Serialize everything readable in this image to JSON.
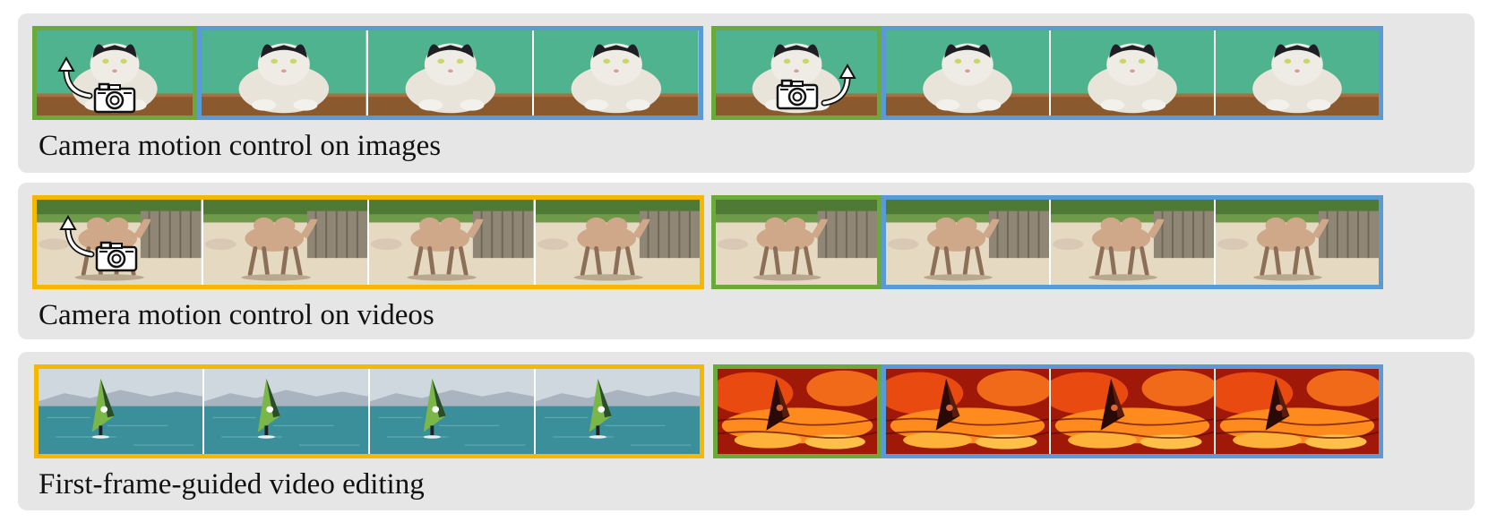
{
  "rows": [
    {
      "caption": "Camera motion control on images"
    },
    {
      "caption": "Camera motion control on videos"
    },
    {
      "caption": "First-frame-guided video editing"
    }
  ],
  "colors": {
    "panel_background": "#e6e6e6",
    "conditioning_frame_border": "#6aaa3a",
    "generated_frames_border": "#5b9bd5",
    "source_video_border": "#f5b800"
  },
  "icons": [
    "camera-icon",
    "curved-arrow-icon"
  ]
}
